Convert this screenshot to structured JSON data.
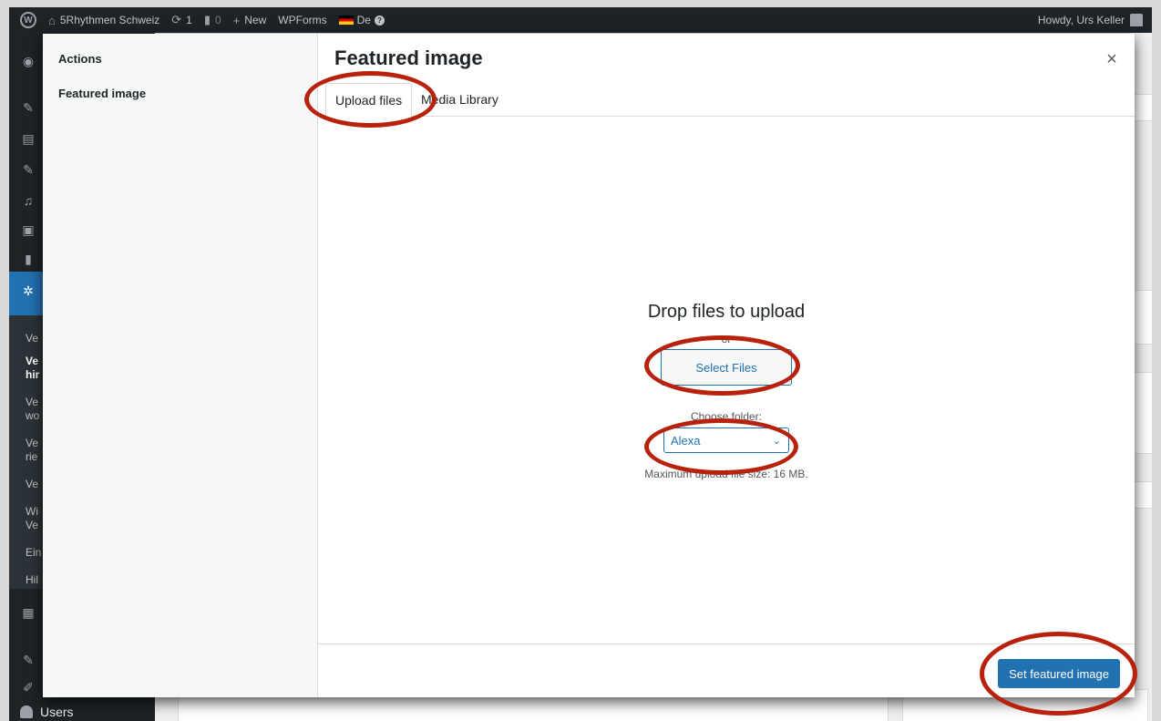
{
  "admin_bar": {
    "site_name": "5Rhythmen Schweiz",
    "updates_count": "1",
    "comments_count": "0",
    "new_label": "New",
    "wpforms_label": "WPForms",
    "language_label": "De",
    "greeting": "Howdy, Urs Keller"
  },
  "admin_menu": {
    "users_label": "Users",
    "submenu_items": [
      {
        "label": "Ve"
      },
      {
        "label": "Ve"
      },
      {
        "label": "hir"
      },
      {
        "label": "Ve"
      },
      {
        "label": "wo"
      },
      {
        "label": "Ve"
      },
      {
        "label": "rie"
      },
      {
        "label": "Ve"
      },
      {
        "label": "Wi"
      },
      {
        "label": "Ve"
      },
      {
        "label": "Ein"
      },
      {
        "label": "Hil"
      }
    ]
  },
  "modal": {
    "title": "Featured image",
    "close_symbol": "×",
    "menu": {
      "actions_label": "Actions",
      "featured_image_label": "Featured image"
    },
    "tabs": [
      {
        "label": "Upload files",
        "active": true
      },
      {
        "label": "Media Library",
        "active": false
      }
    ],
    "uploader": {
      "drop_title": "Drop files to upload",
      "or_text": "or",
      "select_files_label": "Select Files",
      "folder_label": "Choose folder:",
      "folder_selected": "Alexa",
      "max_size_text": "Maximum upload file size: 16 MB."
    },
    "set_button_label": "Set featured image"
  },
  "colors": {
    "primary": "#2271b1",
    "admin_dark": "#1d2327",
    "annotation_red": "#b8220d"
  }
}
